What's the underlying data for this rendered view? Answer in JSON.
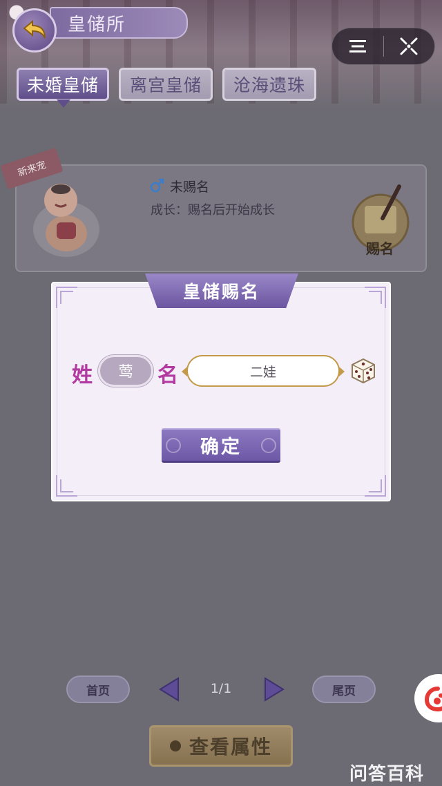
{
  "header": {
    "title": "皇储所"
  },
  "tabs": [
    {
      "label": "未婚皇储",
      "active": true
    },
    {
      "label": "离宫皇储",
      "active": false
    },
    {
      "label": "沧海遗珠",
      "active": false
    }
  ],
  "child_card": {
    "ribbon": "新来宠",
    "name": "未赐名",
    "growth": "成长：赐名后开始成长",
    "bestow_label": "赐名"
  },
  "pagination": {
    "first": "首页",
    "page": "1/1",
    "last": "尾页"
  },
  "attr_button": "查看属性",
  "watermark": "问答百科",
  "modal": {
    "title": "皇储赐名",
    "surname_label": "姓",
    "surname_value": "莺",
    "given_label": "名",
    "given_value": "二娃",
    "confirm": "确定"
  },
  "colors": {
    "accent": "#6c58a6",
    "label_magenta": "#b33aa1",
    "input_gold": "#c29a4a"
  }
}
